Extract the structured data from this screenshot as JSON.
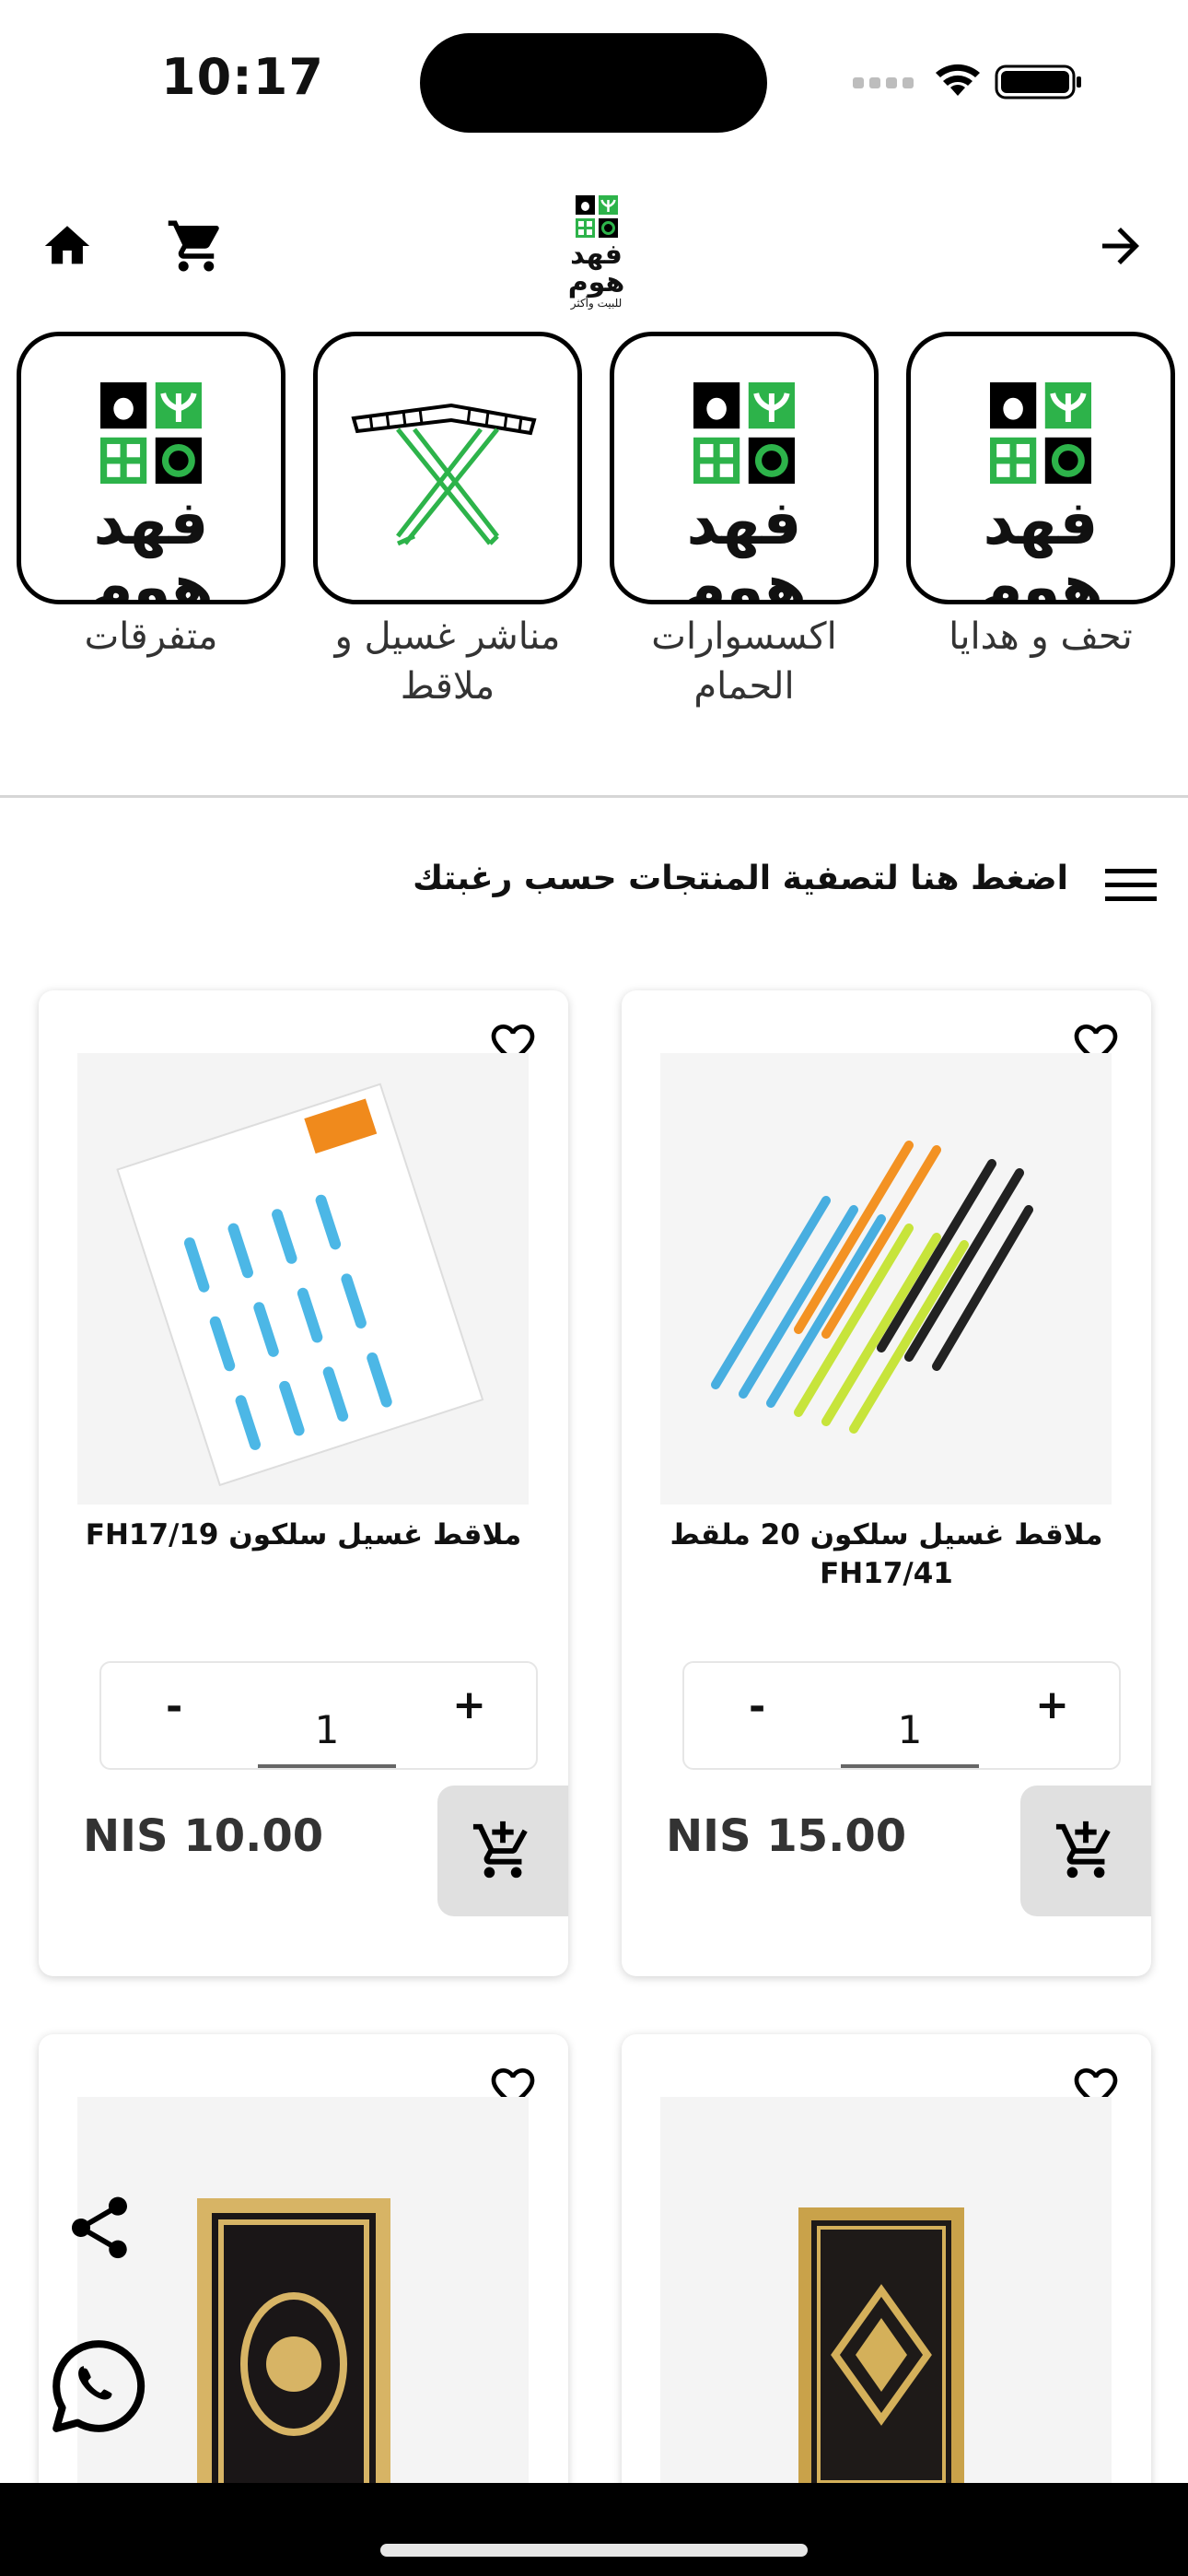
{
  "status": {
    "time": "10:17"
  },
  "header": {
    "logo": {
      "title": "فهد هوم",
      "subtitle": "للبيت وأكثر"
    }
  },
  "categories": [
    {
      "label": "تحف و هدايا",
      "image": "brand-logo"
    },
    {
      "label": "اكسسوارات الحمام",
      "image": "brand-logo"
    },
    {
      "label": "مناشر غسيل و ملاقط",
      "image": "drying-rack"
    },
    {
      "label": "متفرقات",
      "image": "brand-logo"
    }
  ],
  "category_logo_text": "فهد هوم",
  "filter": {
    "label": "اضغط هنا لتصفية المنتجات حسب رغبتك"
  },
  "products": [
    {
      "name": "ملاقط غسيل سلكون 20 ملقط FH17/41",
      "quantity": "1",
      "price": "NIS 15.00",
      "minus": "-",
      "plus": "+"
    },
    {
      "name": "ملاقط غسيل سلكون FH17/19",
      "quantity": "1",
      "price": "NIS 10.00",
      "minus": "-",
      "plus": "+"
    },
    {
      "name": ""
    },
    {
      "name": ""
    }
  ],
  "colors": {
    "brand_green": "#2db34a",
    "black": "#000000",
    "add_cart_bg": "#e0e0e0"
  }
}
